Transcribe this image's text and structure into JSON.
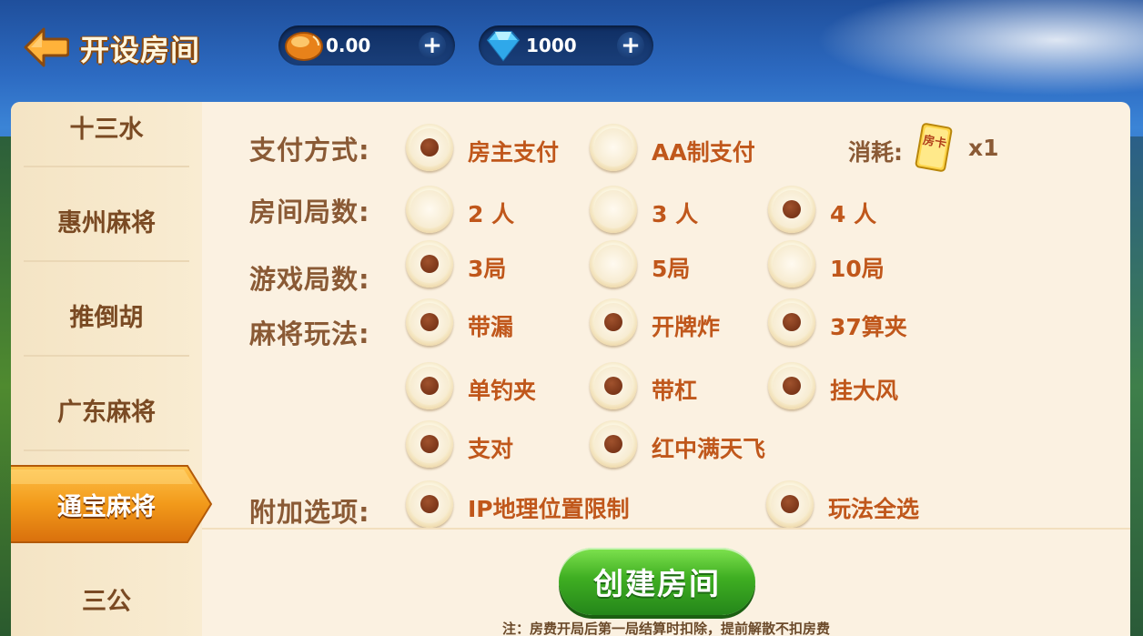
{
  "header": {
    "title": "开设房间",
    "gold_value": "0.00",
    "diamond_value": "1000",
    "back_icon": "back-arrow-icon",
    "gold_icon": "gold-bean-icon",
    "diamond_icon": "diamond-icon",
    "plus_label": "+"
  },
  "sidebar": {
    "items": [
      {
        "label": "十三水"
      },
      {
        "label": "惠州麻将"
      },
      {
        "label": "推倒胡"
      },
      {
        "label": "广东麻将"
      },
      {
        "label": "通宝麻将",
        "active": true
      },
      {
        "label": "三公"
      }
    ]
  },
  "form": {
    "payment": {
      "label": "支付方式:",
      "options": [
        {
          "text": "房主支付",
          "checked": true
        },
        {
          "text": "AA制支付",
          "checked": false
        }
      ],
      "consume_label": "消耗:",
      "card_text": "房卡",
      "consume_count": "x1"
    },
    "players": {
      "label": "房间局数:",
      "options": [
        {
          "text": "2 人",
          "checked": false
        },
        {
          "text": "3 人",
          "checked": false
        },
        {
          "text": "4 人",
          "checked": true
        }
      ]
    },
    "rounds": {
      "label": "游戏局数:",
      "options": [
        {
          "text": "3局",
          "checked": true
        },
        {
          "text": "5局",
          "checked": false
        },
        {
          "text": "10局",
          "checked": false
        }
      ]
    },
    "rules": {
      "label": "麻将玩法:",
      "options": [
        {
          "text": "带漏",
          "checked": true
        },
        {
          "text": "开牌炸",
          "checked": true
        },
        {
          "text": "37算夹",
          "checked": true
        },
        {
          "text": "单钓夹",
          "checked": true
        },
        {
          "text": "带杠",
          "checked": true
        },
        {
          "text": "挂大风",
          "checked": true
        },
        {
          "text": "支对",
          "checked": true
        },
        {
          "text": "红中满天飞",
          "checked": true
        }
      ]
    },
    "extra": {
      "label": "附加选项:",
      "options": [
        {
          "text": "IP地理位置限制",
          "checked": true
        },
        {
          "text": "玩法全选",
          "checked": true
        }
      ]
    }
  },
  "footer": {
    "create_label": "创建房间",
    "note": "注：房费开局后第一局结算时扣除，提前解散不扣房费"
  },
  "colors": {
    "accent_text": "#c0571b",
    "label_text": "#8a5a35",
    "button_green": "#3fae22"
  }
}
